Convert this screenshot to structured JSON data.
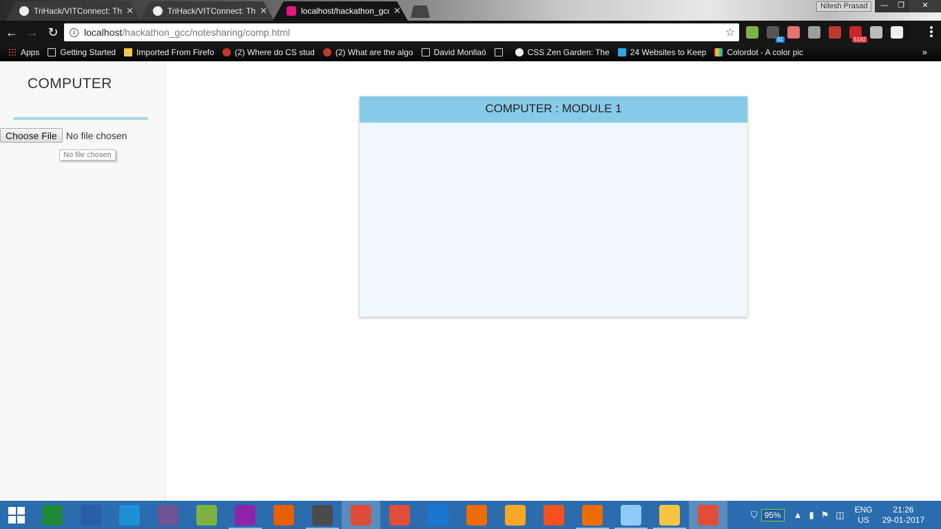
{
  "browser": {
    "tabs": [
      {
        "title": "TriHack/VITConnect: This",
        "active": false
      },
      {
        "title": "TriHack/VITConnect: This",
        "active": false
      },
      {
        "title": "localhost/hackathon_gcc",
        "active": true
      }
    ],
    "profile_name": "Nilesh Prasad",
    "window_buttons": {
      "minimize": "—",
      "restore": "❐",
      "close": "✕"
    },
    "nav": {
      "back": "←",
      "forward": "→",
      "reload": "↻"
    },
    "address": {
      "host": "localhost",
      "path": "/hackathon_gcc/notesharing/comp.html",
      "info_icon": "i",
      "star": "☆"
    },
    "extensions": [
      {
        "name": "todoist-icon",
        "color": "#7cb342",
        "badge": ""
      },
      {
        "name": "google-voice-icon",
        "color": "#555555",
        "badge": "41"
      },
      {
        "name": "pill-icon",
        "color": "#e57373",
        "badge": ""
      },
      {
        "name": "circle-ext-icon",
        "color": "#9e9e9e",
        "badge": ""
      },
      {
        "name": "trello-ext-icon",
        "color": "#c0392b",
        "badge": ""
      },
      {
        "name": "gmail-ext-icon",
        "color": "#c62828",
        "badge": "5192"
      },
      {
        "name": "bulb-icon",
        "color": "#bdbdbd",
        "badge": ""
      },
      {
        "name": "pocket-ext-icon",
        "color": "#eeeeee",
        "badge": ""
      }
    ],
    "bookmarks": [
      {
        "label": "Apps",
        "icon": "grid"
      },
      {
        "label": "Getting Started",
        "icon": "doc"
      },
      {
        "label": "Imported From Firefo",
        "icon": "folder"
      },
      {
        "label": "(2) Where do CS stud",
        "icon": "red"
      },
      {
        "label": "(2) What are the algo",
        "icon": "red"
      },
      {
        "label": "David Monllaó",
        "icon": "doc"
      },
      {
        "label": "",
        "icon": "doc"
      },
      {
        "label": "CSS Zen Garden: The",
        "icon": "gh"
      },
      {
        "label": "24 Websites to Keep",
        "icon": "u"
      },
      {
        "label": "Colordot - A color pic",
        "icon": "cd"
      }
    ],
    "bookmarks_more": "»"
  },
  "sidebar": {
    "title": "COMPUTER",
    "file_button": "Choose File",
    "file_status": "No file chosen",
    "tooltip": "No file chosen"
  },
  "card": {
    "header": "COMPUTER : MODULE 1"
  },
  "taskbar": {
    "apps": [
      {
        "name": "store-icon",
        "color": "#1e8a3a",
        "state": ""
      },
      {
        "name": "powershell-icon",
        "color": "#2a5fa8",
        "state": ""
      },
      {
        "name": "sync-app-icon",
        "color": "#1f8fd6",
        "state": ""
      },
      {
        "name": "github-desktop-icon",
        "color": "#6e5494",
        "state": ""
      },
      {
        "name": "android-studio-icon",
        "color": "#7cb342",
        "state": ""
      },
      {
        "name": "winrar-icon",
        "color": "#8e24aa",
        "state": "running"
      },
      {
        "name": "firefox-icon",
        "color": "#e66000",
        "state": ""
      },
      {
        "name": "sublime-text-icon",
        "color": "#4a4a4a",
        "state": "running"
      },
      {
        "name": "chrome-icon",
        "color": "#dd4b39",
        "state": "active"
      },
      {
        "name": "git-kraken-icon",
        "color": "#e04e39",
        "state": ""
      },
      {
        "name": "virtualbox-icon",
        "color": "#1976d2",
        "state": ""
      },
      {
        "name": "media-player-icon",
        "color": "#ef6c00",
        "state": ""
      },
      {
        "name": "notes-pin-icon",
        "color": "#f9a825",
        "state": ""
      },
      {
        "name": "screen-capture-icon",
        "color": "#f4511e",
        "state": ""
      },
      {
        "name": "foxit-pdf-icon",
        "color": "#ef6c00",
        "state": "running"
      },
      {
        "name": "notepad-icon",
        "color": "#90caf9",
        "state": "running"
      },
      {
        "name": "file-explorer-icon",
        "color": "#f6c343",
        "state": "running"
      },
      {
        "name": "git-icon",
        "color": "#e04e39",
        "state": "active"
      }
    ],
    "battery": "95%",
    "tray_up": "▲",
    "lang_top": "ENG",
    "lang_bottom": "US",
    "time": "21:26",
    "date": "29-01-2017"
  }
}
